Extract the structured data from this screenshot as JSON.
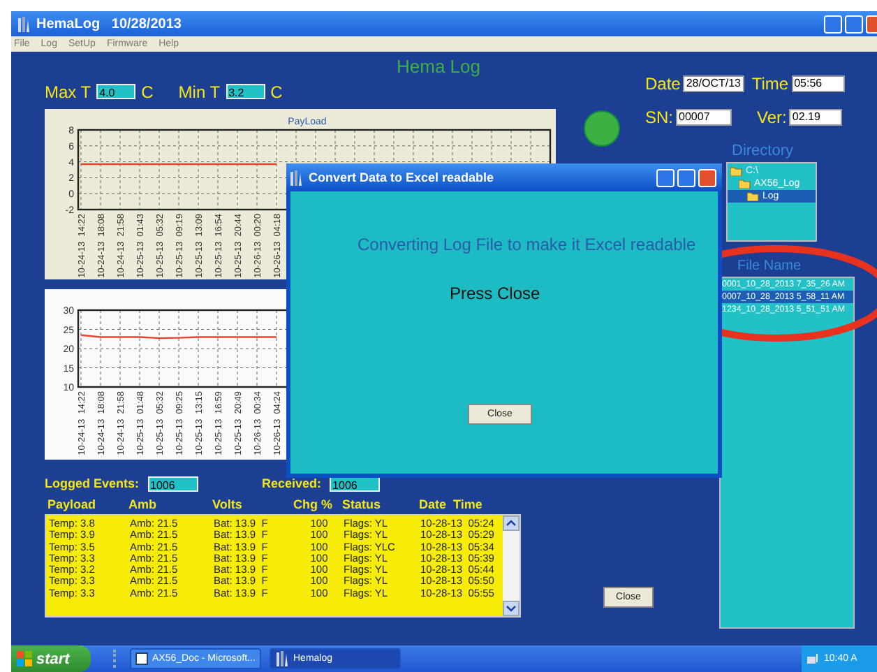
{
  "window": {
    "title": "HemaLog   10/28/2013"
  },
  "menu": [
    "File",
    "Log",
    "SetUp",
    "Firmware",
    "Help"
  ],
  "app_title": "Hema Log",
  "max_t": {
    "label": "Max T",
    "value": "4.0",
    "unit": "C"
  },
  "min_t": {
    "label": "Min T",
    "value": "3.2",
    "unit": "C"
  },
  "date": {
    "label": "Date",
    "value": "28/OCT/13"
  },
  "time": {
    "label": "Time",
    "value": "05:56"
  },
  "sn": {
    "label": "SN:",
    "value": "00007"
  },
  "ver": {
    "label": "Ver:",
    "value": "02.19"
  },
  "charts": [
    {
      "chart_data": {
        "type": "line",
        "title": "PayLoad",
        "categories": [
          "10-24-13  14:22",
          "10-24-13  18:08",
          "10-24-13  21:58",
          "10-25-13  01:43",
          "10-25-13  05:32",
          "10-25-13  09:19",
          "10-25-13  13:09",
          "10-25-13  16:54",
          "10-25-13  20:44",
          "10-26-13  00:20",
          "10-26-13  04:18"
        ],
        "ylim": [
          -2,
          8
        ],
        "yticks": [
          -2,
          0,
          2,
          4,
          6,
          8
        ],
        "grid": true,
        "series": [
          {
            "color": "#e8442c",
            "values": [
              3.7,
              3.7,
              3.7,
              3.7,
              3.7,
              3.7,
              3.7,
              3.7,
              3.7,
              3.7,
              3.7
            ]
          }
        ]
      }
    },
    {
      "chart_data": {
        "type": "line",
        "categories": [
          "10-24-13  14:22",
          "10-24-13  18:08",
          "10-24-13  21:58",
          "10-25-13  01:48",
          "10-25-13  05:32",
          "10-25-13  09:25",
          "10-25-13  13:15",
          "10-25-13  16:59",
          "10-25-13  20:49",
          "10-26-13  00:34",
          "10-26-13  04:24"
        ],
        "ylim": [
          10,
          30
        ],
        "yticks": [
          10,
          15,
          20,
          25,
          30
        ],
        "grid": true,
        "series": [
          {
            "color": "#e8442c",
            "values": [
              23.5,
              23,
              23,
              23,
              22.7,
              22.8,
              23,
              23,
              23,
              23,
              23
            ]
          }
        ]
      }
    }
  ],
  "logged_events": {
    "label": "Logged Events:",
    "value": "1006"
  },
  "received": {
    "label": "Received:",
    "value": "1006"
  },
  "log_table": {
    "columns": [
      "Payload",
      "Amb",
      "Volts",
      "Chg %",
      "Status",
      "Date  Time"
    ],
    "rows": [
      [
        "Temp: 3.8",
        "Amb: 21.5",
        "Bat: 13.9  F",
        "100",
        "Flags: YL",
        "10-28-13  05:24"
      ],
      [
        "Temp: 3.9",
        "Amb: 21.5",
        "Bat: 13.9  F",
        "100",
        "Flags: YL",
        "10-28-13  05:29"
      ],
      [
        "Temp: 3.5",
        "Amb: 21.5",
        "Bat: 13.9  F",
        "100",
        "Flags: YLC",
        "10-28-13  05:34"
      ],
      [
        "Temp: 3.3",
        "Amb: 21.5",
        "Bat: 13.9  F",
        "100",
        "Flags: YL",
        "10-28-13  05:39"
      ],
      [
        "Temp: 3.2",
        "Amb: 21.5",
        "Bat: 13.9  F",
        "100",
        "Flags: YL",
        "10-28-13  05:44"
      ],
      [
        "Temp: 3.3",
        "Amb: 21.5",
        "Bat: 13.9  F",
        "100",
        "Flags: YL",
        "10-28-13  05:50"
      ],
      [
        "Temp: 3.3",
        "Amb: 21.5",
        "Bat: 13.9  F",
        "100",
        "Flags: YL",
        "10-28-13  05:55"
      ]
    ]
  },
  "directory": {
    "label": "Directory",
    "tree": [
      {
        "label": "C:\\",
        "selected": false,
        "children": [
          {
            "label": "AX56_Log",
            "selected": false,
            "children": [
              {
                "label": "Log",
                "selected": true
              }
            ]
          }
        ]
      }
    ]
  },
  "file_list": {
    "label": "File Name",
    "items": [
      {
        "label": "0001_10_28_2013 7_35_26 AM",
        "selected": false
      },
      {
        "label": "0007_10_28_2013 5_58_11 AM",
        "selected": true
      },
      {
        "label": "1234_10_28_2013 5_51_51 AM",
        "selected": false
      }
    ]
  },
  "close_button": "Close",
  "dialog": {
    "title": "Convert Data to Excel readable",
    "message": "Converting Log File to make it Excel readable",
    "instruction": "Press Close",
    "button": "Close"
  },
  "taskbar": {
    "start": "start",
    "tasks": [
      {
        "label": "AX56_Doc - Microsoft...",
        "selected": false
      },
      {
        "label": "Hemalog",
        "selected": true
      }
    ],
    "clock": "10:40 A"
  }
}
